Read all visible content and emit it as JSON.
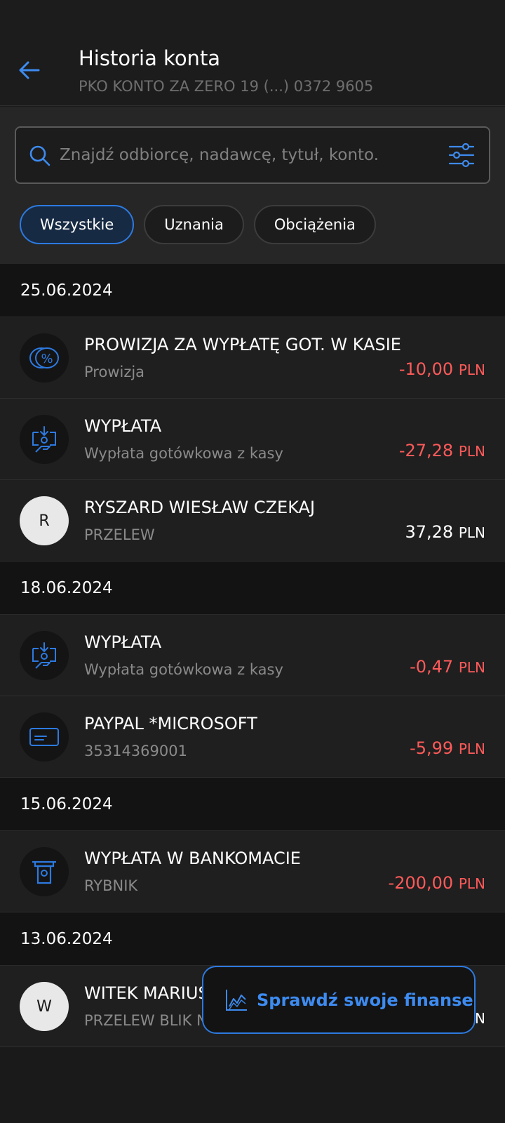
{
  "header": {
    "title": "Historia konta",
    "subtitle": "PKO KONTO ZA ZERO 19 (...) 0372 9605"
  },
  "search": {
    "placeholder": "Znajdź odbiorcę, nadawcę, tytuł, konto."
  },
  "chips": [
    {
      "label": "Wszystkie",
      "active": true
    },
    {
      "label": "Uznania",
      "active": false
    },
    {
      "label": "Obciążenia",
      "active": false
    }
  ],
  "groups": [
    {
      "date": "25.06.2024",
      "items": [
        {
          "icon": "percent-icon",
          "name": "PROWIZJA ZA WYPŁATĘ GOT. W KASIE",
          "desc": "Prowizja",
          "amount": "-10,00",
          "currency": "PLN"
        },
        {
          "icon": "cash-withdrawal-icon",
          "name": "WYPŁATA",
          "desc": "Wypłata gotówkowa z kasy",
          "amount": "-27,28",
          "currency": "PLN"
        },
        {
          "icon": "avatar",
          "avatar_letter": "R",
          "name": "RYSZARD WIESŁAW CZEKAJ",
          "desc": "PRZELEW",
          "amount": "37,28",
          "currency": "PLN"
        }
      ]
    },
    {
      "date": "18.06.2024",
      "items": [
        {
          "icon": "cash-withdrawal-icon",
          "name": "WYPŁATA",
          "desc": "Wypłata gotówkowa z kasy",
          "amount": "-0,47",
          "currency": "PLN"
        },
        {
          "icon": "card-icon",
          "name": "PAYPAL *MICROSOFT",
          "desc": "35314369001",
          "amount": "-5,99",
          "currency": "PLN"
        }
      ]
    },
    {
      "date": "15.06.2024",
      "items": [
        {
          "icon": "atm-icon",
          "name": "WYPŁATA W BANKOMACIE",
          "desc": "RYBNIK",
          "amount": "-200,00",
          "currency": "PLN"
        }
      ]
    },
    {
      "date": "13.06.2024",
      "items": [
        {
          "icon": "avatar",
          "avatar_letter": "W",
          "name": "WITEK MARIUSZ",
          "desc": "PRZELEW BLIK N",
          "amount": "",
          "currency": "PLN"
        }
      ]
    }
  ],
  "fab": {
    "label": "Sprawdź swoje finanse",
    "icon": "chart-icon"
  },
  "colors": {
    "accent": "#2d7ae0",
    "negative": "#ff5a5a",
    "background": "#1a1a1a"
  }
}
